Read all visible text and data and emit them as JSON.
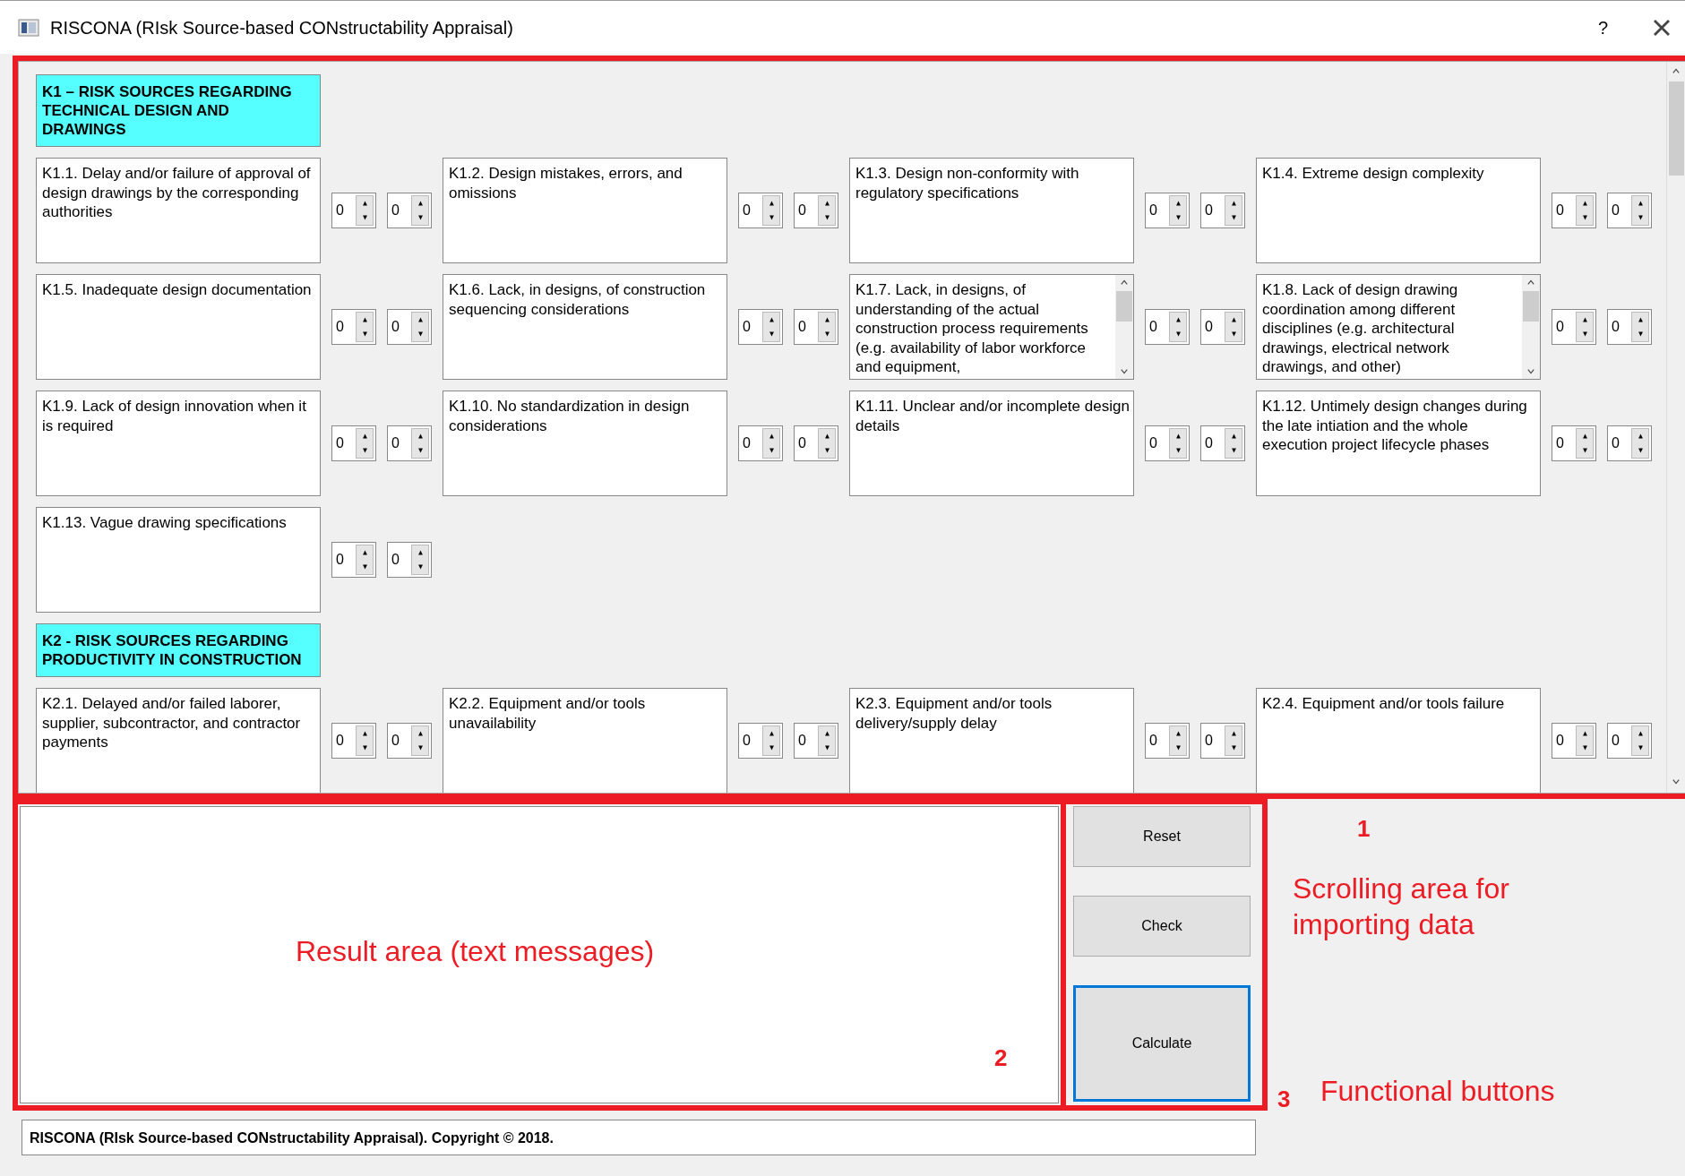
{
  "window": {
    "title": "RISCONA (RIsk Source-based CONstructability Appraisal)",
    "help": "?"
  },
  "sections": [
    {
      "title": "K1 – RISK SOURCES REGARDING TECHNICAL DESIGN AND DRAWINGS",
      "items": [
        {
          "text": "K1.1. Delay and/or failure of approval of design drawings by the corresponding authorities",
          "scrollable": false,
          "values": [
            "0",
            "0"
          ]
        },
        {
          "text": "K1.2. Design mistakes, errors, and omissions",
          "scrollable": false,
          "values": [
            "0",
            "0"
          ]
        },
        {
          "text": "K1.3. Design non-conformity with regulatory specifications",
          "scrollable": false,
          "values": [
            "0",
            "0"
          ]
        },
        {
          "text": "K1.4. Extreme design complexity",
          "scrollable": false,
          "values": [
            "0",
            "0"
          ]
        },
        {
          "text": "K1.5. Inadequate design documentation",
          "scrollable": false,
          "values": [
            "0",
            "0"
          ]
        },
        {
          "text": "K1.6. Lack, in designs, of construction sequencing considerations",
          "scrollable": false,
          "values": [
            "0",
            "0"
          ]
        },
        {
          "text": "K1.7. Lack, in designs, of understanding of the actual construction process requirements (e.g. availability of labor workforce and equipment,",
          "scrollable": true,
          "values": [
            "0",
            "0"
          ]
        },
        {
          "text": "K1.8. Lack of design drawing coordination among different disciplines (e.g. architectural drawings, electrical network drawings, and other)",
          "scrollable": true,
          "values": [
            "0",
            "0"
          ]
        },
        {
          "text": "K1.9. Lack of design innovation when it is required",
          "scrollable": false,
          "values": [
            "0",
            "0"
          ]
        },
        {
          "text": "K1.10. No standardization in design considerations",
          "scrollable": false,
          "values": [
            "0",
            "0"
          ]
        },
        {
          "text": "K1.11. Unclear and/or incomplete design details",
          "scrollable": false,
          "values": [
            "0",
            "0"
          ]
        },
        {
          "text": "K1.12. Untimely design changes during the late intiation and the whole execution project lifecycle phases",
          "scrollable": false,
          "values": [
            "0",
            "0"
          ]
        },
        {
          "text": "K1.13. Vague drawing specifications",
          "scrollable": false,
          "values": [
            "0",
            "0"
          ]
        }
      ]
    },
    {
      "title": "K2 - RISK SOURCES REGARDING PRODUCTIVITY IN CONSTRUCTION",
      "items": [
        {
          "text": "K2.1. Delayed and/or failed laborer, supplier, subcontractor, and contractor payments",
          "scrollable": false,
          "values": [
            "0",
            "0"
          ]
        },
        {
          "text": "K2.2. Equipment and/or tools unavailability",
          "scrollable": false,
          "values": [
            "0",
            "0"
          ]
        },
        {
          "text": "K2.3. Equipment and/or tools delivery/supply delay",
          "scrollable": false,
          "values": [
            "0",
            "0"
          ]
        },
        {
          "text": "K2.4. Equipment and/or tools failure",
          "scrollable": false,
          "values": [
            "0",
            "0"
          ]
        }
      ]
    }
  ],
  "buttons": [
    {
      "label": "Reset",
      "focused": false
    },
    {
      "label": "Check",
      "focused": false
    },
    {
      "label": "Calculate",
      "focused": true
    }
  ],
  "status_bar": "RISCONA (RIsk Source-based CONstructability Appraisal). Copyright © 2018.",
  "annotations": [
    {
      "kind": "number",
      "text": "1"
    },
    {
      "kind": "caption",
      "text": "Scrolling area for importing data"
    },
    {
      "kind": "caption",
      "text": "Result area (text messages)"
    },
    {
      "kind": "number",
      "text": "2"
    },
    {
      "kind": "number",
      "text": "3"
    },
    {
      "kind": "caption",
      "text": "Functional buttons"
    }
  ]
}
